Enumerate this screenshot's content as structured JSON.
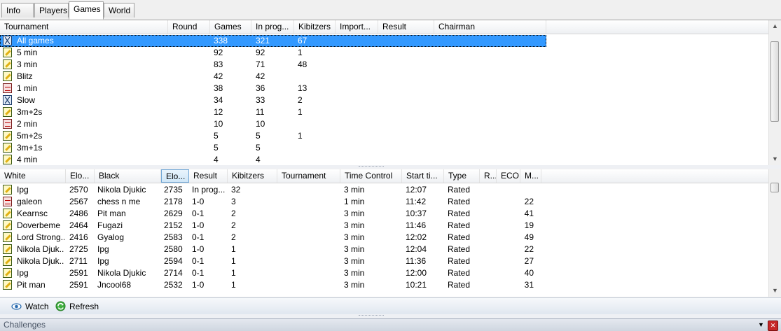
{
  "tabs": [
    {
      "label": "Info",
      "active": false
    },
    {
      "label": "Players",
      "active": false
    },
    {
      "label": "Games",
      "active": true
    },
    {
      "label": "World",
      "active": false
    }
  ],
  "tournaments": {
    "columns": [
      "Tournament",
      "Round",
      "Games",
      "In prog...",
      "Kibitzers",
      "Import...",
      "Result",
      "Chairman"
    ],
    "rows": [
      {
        "icon": "hourglass-icon",
        "name": "All games",
        "round": "",
        "games": "338",
        "in_progress": "321",
        "kibitzers": "67",
        "selected": true
      },
      {
        "icon": "pencil-icon",
        "name": "5 min",
        "round": "",
        "games": "92",
        "in_progress": "92",
        "kibitzers": "1",
        "selected": false
      },
      {
        "icon": "pencil-icon",
        "name": "3 min",
        "round": "",
        "games": "83",
        "in_progress": "71",
        "kibitzers": "48",
        "selected": false
      },
      {
        "icon": "pencil-icon",
        "name": "Blitz",
        "round": "",
        "games": "42",
        "in_progress": "42",
        "kibitzers": "",
        "selected": false
      },
      {
        "icon": "clock-icon",
        "name": "1 min",
        "round": "",
        "games": "38",
        "in_progress": "36",
        "kibitzers": "13",
        "selected": false
      },
      {
        "icon": "hourglass-icon",
        "name": "Slow",
        "round": "",
        "games": "34",
        "in_progress": "33",
        "kibitzers": "2",
        "selected": false
      },
      {
        "icon": "pencil-icon",
        "name": "3m+2s",
        "round": "",
        "games": "12",
        "in_progress": "11",
        "kibitzers": "1",
        "selected": false
      },
      {
        "icon": "clock-icon",
        "name": "2 min",
        "round": "",
        "games": "10",
        "in_progress": "10",
        "kibitzers": "",
        "selected": false
      },
      {
        "icon": "pencil-icon",
        "name": "5m+2s",
        "round": "",
        "games": "5",
        "in_progress": "5",
        "kibitzers": "1",
        "selected": false
      },
      {
        "icon": "pencil-icon",
        "name": "3m+1s",
        "round": "",
        "games": "5",
        "in_progress": "5",
        "kibitzers": "",
        "selected": false
      },
      {
        "icon": "pencil-icon",
        "name": "4 min",
        "round": "",
        "games": "4",
        "in_progress": "4",
        "kibitzers": "",
        "selected": false
      }
    ]
  },
  "games": {
    "columns": [
      "White",
      "Elo...",
      "Black",
      "Elo...",
      "Result",
      "Kibitzers",
      "Tournament",
      "Time Control",
      "Start ti...",
      "Type",
      "R...",
      "ECO",
      "M..."
    ],
    "sorted_column": 3,
    "rows": [
      {
        "icon": "pencil-icon",
        "white": "Ipg",
        "white_elo": "2570",
        "black": "Nikola Djukic",
        "black_elo": "2735",
        "result": "In prog...",
        "kibitzers": "32",
        "tournament": "",
        "time_control": "3 min",
        "start": "12:07",
        "type": "Rated",
        "r": "",
        "eco": "",
        "m": ""
      },
      {
        "icon": "clock-icon",
        "white": "galeon",
        "white_elo": "2567",
        "black": "chess n me",
        "black_elo": "2178",
        "result": "1-0",
        "kibitzers": "3",
        "tournament": "",
        "time_control": "1 min",
        "start": "11:42",
        "type": "Rated",
        "r": "",
        "eco": "",
        "m": "22"
      },
      {
        "icon": "pencil-icon",
        "white": "Kearnsc",
        "white_elo": "2486",
        "black": "Pit man",
        "black_elo": "2629",
        "result": "0-1",
        "kibitzers": "2",
        "tournament": "",
        "time_control": "3 min",
        "start": "10:37",
        "type": "Rated",
        "r": "",
        "eco": "",
        "m": "41"
      },
      {
        "icon": "pencil-icon",
        "white": "Doverbeme",
        "white_elo": "2464",
        "black": "Fugazi",
        "black_elo": "2152",
        "result": "1-0",
        "kibitzers": "2",
        "tournament": "",
        "time_control": "3 min",
        "start": "11:46",
        "type": "Rated",
        "r": "",
        "eco": "",
        "m": "19"
      },
      {
        "icon": "pencil-icon",
        "white": "Lord Strong...",
        "white_elo": "2416",
        "black": "Gyalog",
        "black_elo": "2583",
        "result": "0-1",
        "kibitzers": "2",
        "tournament": "",
        "time_control": "3 min",
        "start": "12:02",
        "type": "Rated",
        "r": "",
        "eco": "",
        "m": "49"
      },
      {
        "icon": "pencil-icon",
        "white": "Nikola Djuk...",
        "white_elo": "2725",
        "black": "Ipg",
        "black_elo": "2580",
        "result": "1-0",
        "kibitzers": "1",
        "tournament": "",
        "time_control": "3 min",
        "start": "12:04",
        "type": "Rated",
        "r": "",
        "eco": "",
        "m": "22"
      },
      {
        "icon": "pencil-icon",
        "white": "Nikola Djuk...",
        "white_elo": "2711",
        "black": "Ipg",
        "black_elo": "2594",
        "result": "0-1",
        "kibitzers": "1",
        "tournament": "",
        "time_control": "3 min",
        "start": "11:36",
        "type": "Rated",
        "r": "",
        "eco": "",
        "m": "27"
      },
      {
        "icon": "pencil-icon",
        "white": "Ipg",
        "white_elo": "2591",
        "black": "Nikola Djukic",
        "black_elo": "2714",
        "result": "0-1",
        "kibitzers": "1",
        "tournament": "",
        "time_control": "3 min",
        "start": "12:00",
        "type": "Rated",
        "r": "",
        "eco": "",
        "m": "40"
      },
      {
        "icon": "pencil-icon",
        "white": "Pit man",
        "white_elo": "2591",
        "black": "Jncool68",
        "black_elo": "2532",
        "result": "1-0",
        "kibitzers": "1",
        "tournament": "",
        "time_control": "3 min",
        "start": "10:21",
        "type": "Rated",
        "r": "",
        "eco": "",
        "m": "31"
      }
    ]
  },
  "toolbar": {
    "watch_label": "Watch",
    "refresh_label": "Refresh"
  },
  "challenges": {
    "title": "Challenges"
  },
  "colors": {
    "selection": "#3399ff",
    "sorted_header": "#cfe6f7"
  }
}
